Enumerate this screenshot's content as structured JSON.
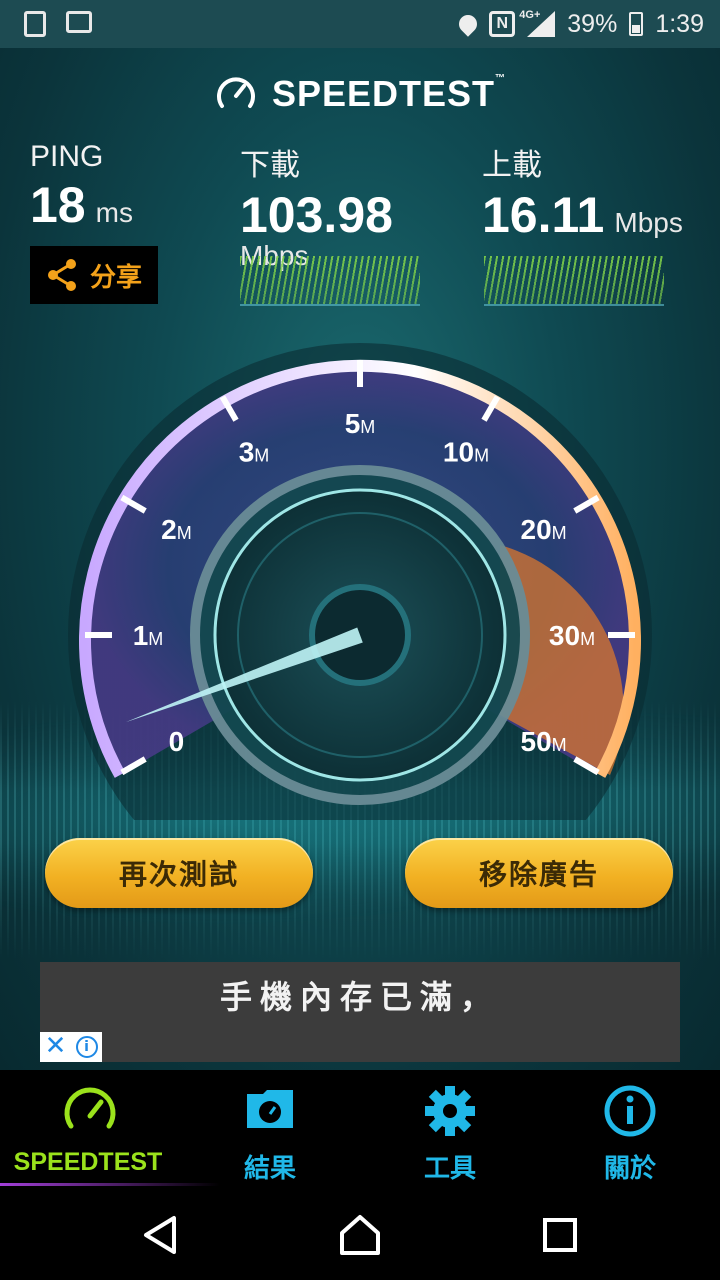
{
  "status_bar": {
    "network": "4G+",
    "battery": "39%",
    "time": "1:39"
  },
  "header": {
    "logo": "SPEEDTEST",
    "trademark": "™"
  },
  "ping": {
    "label": "PING",
    "value": "18",
    "unit": "ms"
  },
  "share": {
    "label": "分享"
  },
  "download": {
    "label": "下載",
    "value": "103.98",
    "unit": "Mbps"
  },
  "upload": {
    "label": "上載",
    "value": "16.11",
    "unit": "Mbps"
  },
  "gauge": {
    "ticks": [
      {
        "num": "0",
        "unit": ""
      },
      {
        "num": "1",
        "unit": "M"
      },
      {
        "num": "2",
        "unit": "M"
      },
      {
        "num": "3",
        "unit": "M"
      },
      {
        "num": "5",
        "unit": "M"
      },
      {
        "num": "10",
        "unit": "M"
      },
      {
        "num": "20",
        "unit": "M"
      },
      {
        "num": "30",
        "unit": "M"
      },
      {
        "num": "50",
        "unit": "M"
      }
    ],
    "needle_fraction": 0.04
  },
  "buttons": {
    "retest": "再次測試",
    "remove_ads": "移除廣告"
  },
  "ad": {
    "text": "手機內存已滿，",
    "close": "✕",
    "info": "i"
  },
  "tabs": [
    {
      "label": "SPEEDTEST",
      "icon": "speedometer-icon",
      "active": true
    },
    {
      "label": "結果",
      "icon": "results-folder-icon"
    },
    {
      "label": "工具",
      "icon": "gear-icon"
    },
    {
      "label": "關於",
      "icon": "info-icon"
    }
  ],
  "colors": {
    "accent_green": "#9be21c",
    "accent_blue": "#20b8e8",
    "button_gold": "#f2b123",
    "gauge_orange": "#ff9a3c"
  }
}
